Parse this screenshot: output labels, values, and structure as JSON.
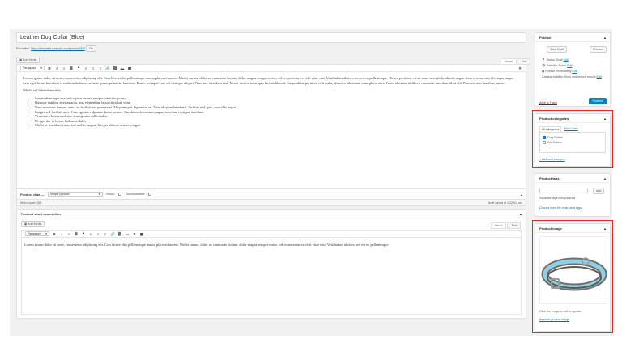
{
  "post": {
    "title": "Leather Dog Collar (Blue)",
    "permalink_label": "Permalink:",
    "permalink_url": "https://demosite.example.com/product/53/",
    "permalink_ok": "OK"
  },
  "editor": {
    "add_media": "Add Media",
    "tab_visual": "Visual",
    "tab_text": "Text",
    "format_select": "Paragraph",
    "p1": "Lorem ipsum dolor sit amet, consectetur adipiscing elit. Cras laoreet dui pellentesque massa placerat laoreet. Morbi cursus, dolor ac commodo lacinia, dolor magna semper tortor, vel consectetur ex velit vitae nisi. Vestibulum ultrices nec est eu pellentesque. Donec porttitor, est sit amet suscipit hendrerit, augue risus viverra nisi, id tempor augue sem eget lacus. Interdum et malesuada fames ac ante ipsum primis in faucibus. Donec volutpat eros vel tristique aliquet. Nam nec interdum nisi. Morbi viverra nunc quis lacinia blandit. Suspendisse porttitor velit nulla, pharetra bibendum nunc placerat et. Fusce id massa ut libero venenatis interdum id eu elit. Praesent non faucibus purus.",
    "p2": "Morbi vel bibendum velit:",
    "bullets": [
      "Suspendisse eget arcu sed sapien lacinia semper vitae nec purus.",
      "Quisque dapibus egestas arcu, non elementum lacus tincidunt vitae.",
      "Nam maximus tempus nunc, ac facilisis est posuere et. Aliquam quis dignissim ex. Nam id quam hendrerit, facilisis nisl quis, convallis augue.",
      "Integer sed facilisis ante. Cras egestas vulputate dui ac ornare. Curabitur elementum augue interdum tristique tincidunt.",
      "Vivamus a lectus molestie sem egestas sollicitudin.",
      "Ut eget dui in lorem finibus sodales.",
      "Morbi ac tincidunt enim, sed mollis magna. Integer ultrices ornare congue."
    ],
    "word_count": "Word count: 169",
    "draft_saved": "Draft saved at 1:22:51 pm."
  },
  "product_data": {
    "label": "Product data —",
    "type_select": "Simple product",
    "virtual_label": "Virtual:",
    "downloadable_label": "Downloadable:"
  },
  "short_description": {
    "title": "Product short description",
    "add_media": "Add Media",
    "tab_visual": "Visual",
    "tab_text": "Text",
    "format_select": "Paragraph",
    "text": "Lorem ipsum dolor sit amet, consectetur adipiscing elit. Cras laoreet dui pellentesque massa placerat laoreet. Morbi cursus, dolor ac commodo lacinia, dolor magna semper tortor, vel consectetur ex velit vitae nisi. Vestibulum ultrices nec est eu pellentesque."
  },
  "publish": {
    "title": "Publish",
    "save_draft": "Save Draft",
    "preview": "Preview",
    "status": "Status: Draft",
    "visibility": "Visibility: Public",
    "publish_time": "Publish immediately",
    "edit": "Edit",
    "catalog": "Catalog visibility: Shop and search results",
    "move_trash": "Move to Trash",
    "publish_button": "Publish"
  },
  "categories": {
    "title": "Product categories",
    "tab_all": "All categories",
    "tab_most_used": "Most Used",
    "items": [
      {
        "label": "Dog Collars",
        "checked": true
      },
      {
        "label": "Cat Collars",
        "checked": false
      }
    ],
    "add_new": "+ Add new category"
  },
  "tags": {
    "title": "Product tags",
    "add_button": "Add",
    "hint": "Separate tags with commas",
    "choose": "Choose from the most used tags"
  },
  "product_image": {
    "title": "Product image",
    "hint": "Click the image to edit or update",
    "remove": "Remove product image"
  },
  "colors": {
    "highlight": "#e32a2a",
    "publish_button": "#0085ba",
    "collar_blue": "#8fd0e8",
    "collar_strap": "#6f6f6a"
  }
}
